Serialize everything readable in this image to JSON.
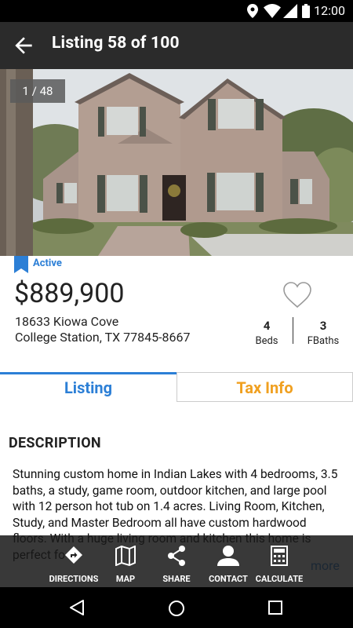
{
  "status_bar": {
    "time": "12:00"
  },
  "header": {
    "title": "Listing 58 of 100"
  },
  "photo": {
    "counter": "1 / 48"
  },
  "listing": {
    "status": "Active",
    "price": "$889,900",
    "address_line1": "18633 Kiowa Cove",
    "address_line2": "College Station, TX 77845-8667",
    "beds": {
      "value": "4",
      "label": "Beds"
    },
    "baths": {
      "value": "3",
      "label": "FBaths"
    }
  },
  "tabs": [
    {
      "label": "Listing",
      "active": true
    },
    {
      "label": "Tax Info",
      "active": false
    }
  ],
  "description": {
    "heading": "DESCRIPTION",
    "body": "Stunning custom home in Indian Lakes with 4 bedrooms, 3.5 baths, a study, game room, outdoor kitchen, and large pool with 12 person hot tub on 1.4 acres. Living Room, Kitchen, Study, and Master Bedroom all have custom hardwood floors. With a huge living room and kitchen this home is perfect fo",
    "more_label": "more"
  },
  "actions": [
    {
      "label": "DIRECTIONS",
      "icon": "directions-icon"
    },
    {
      "label": "MAP",
      "icon": "map-icon"
    },
    {
      "label": "SHARE",
      "icon": "share-icon"
    },
    {
      "label": "CONTACT",
      "icon": "contact-icon"
    },
    {
      "label": "CALCULATE",
      "icon": "calculator-icon"
    }
  ],
  "colors": {
    "accent": "#2c7fd6",
    "tax_tab": "#f0a020",
    "app_bar": "#2b2b2b"
  }
}
